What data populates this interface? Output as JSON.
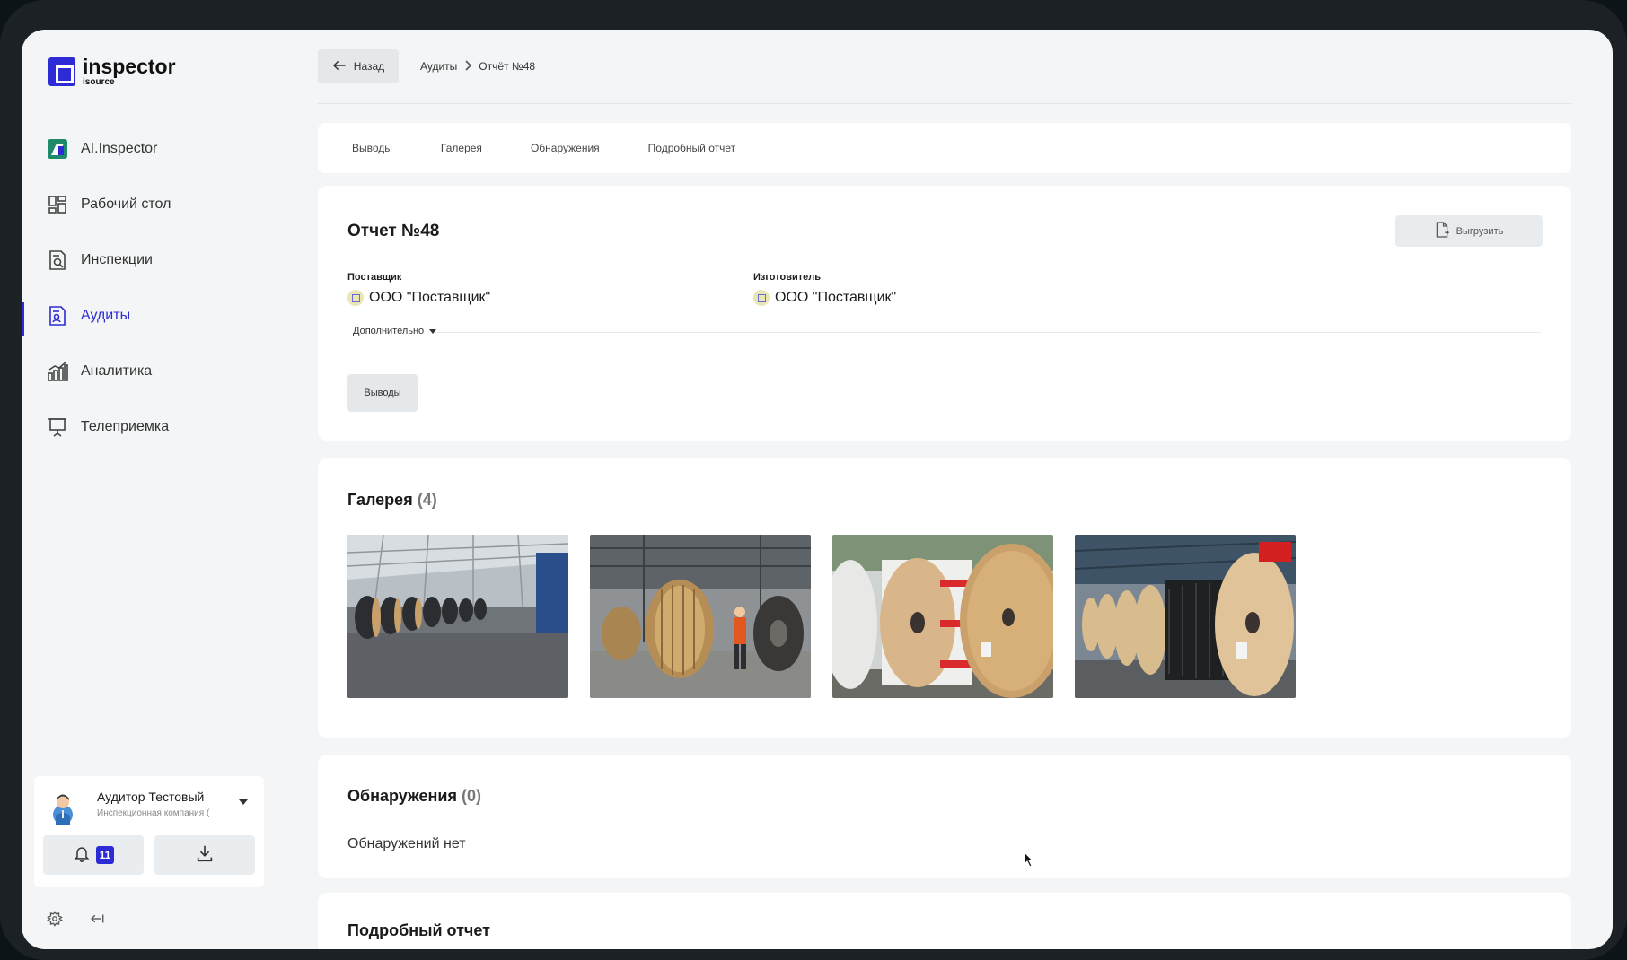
{
  "app": {
    "logo_name": "inspector",
    "logo_sub": "isource",
    "accent": "#2d2bd6"
  },
  "sidebar": {
    "items": [
      {
        "label": "AI.Inspector",
        "icon": "ai-inspector-icon"
      },
      {
        "label": "Рабочий стол",
        "icon": "dashboard-icon"
      },
      {
        "label": "Инспекции",
        "icon": "inspection-doc-icon"
      },
      {
        "label": "Аудиты",
        "icon": "audit-doc-icon",
        "active": true
      },
      {
        "label": "Аналитика",
        "icon": "analytics-chart-icon"
      },
      {
        "label": "Телеприемка",
        "icon": "presentation-board-icon"
      }
    ]
  },
  "user": {
    "name": "Аудитор Тестовый",
    "org": "Инспекционная компания (",
    "notifications": "11"
  },
  "topbar": {
    "back_label": "Назад",
    "breadcrumb": [
      "Аудиты",
      "Отчёт №48"
    ]
  },
  "tabs": [
    "Выводы",
    "Галерея",
    "Обнаружения",
    "Подробный отчет"
  ],
  "report": {
    "title": "Отчет №48",
    "export_label": "Выгрузить",
    "supplier_label": "Поставщик",
    "supplier_value": "ООО \"Поставщик\"",
    "manufacturer_label": "Изготовитель",
    "manufacturer_value": "ООО \"Поставщик\"",
    "more_label": "Дополнительно",
    "conclusions_button": "Выводы"
  },
  "gallery": {
    "title": "Галерея",
    "count": "(4)",
    "photos": [
      "cable-reels-warehouse-photo",
      "worker-cable-drum-photo",
      "wooden-reels-outdoor-photo",
      "black-cable-reels-photo"
    ]
  },
  "findings": {
    "title": "Обнаружения",
    "count": "(0)",
    "empty_text": "Обнаружений нет"
  },
  "detailed": {
    "title": "Подробный отчет"
  }
}
